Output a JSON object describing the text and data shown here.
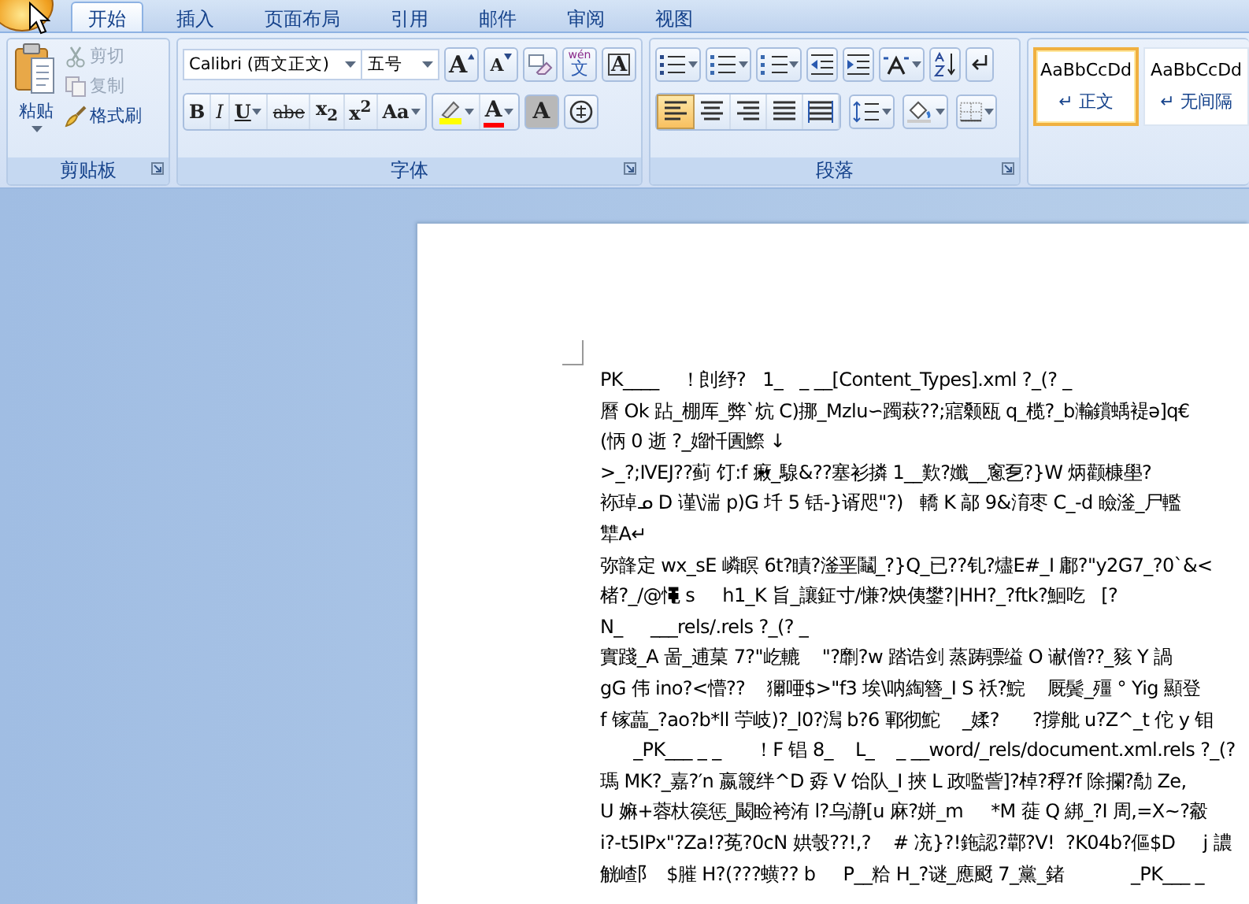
{
  "tabs": [
    {
      "label": "开始",
      "selected": true
    },
    {
      "label": "插入",
      "selected": false
    },
    {
      "label": "页面布局",
      "selected": false
    },
    {
      "label": "引用",
      "selected": false
    },
    {
      "label": "邮件",
      "selected": false
    },
    {
      "label": "审阅",
      "selected": false
    },
    {
      "label": "视图",
      "selected": false
    }
  ],
  "clipboard": {
    "paste": "粘贴",
    "group_label": "剪贴板",
    "items": [
      {
        "label": "剪切",
        "kind": "cut",
        "disabled": true
      },
      {
        "label": "复制",
        "kind": "copy",
        "disabled": true
      },
      {
        "label": "格式刷",
        "kind": "brush",
        "disabled": false
      }
    ]
  },
  "font": {
    "font_name": "Calibri (西文正文)",
    "font_size": "五号",
    "group_label": "字体",
    "top_buttons": [
      {
        "kind": "grow",
        "label": "A"
      },
      {
        "kind": "shrink",
        "label": "A"
      },
      {
        "kind": "clear"
      },
      {
        "kind": "phonetic",
        "label": "wén",
        "base": "文"
      },
      {
        "kind": "border",
        "label": "A"
      }
    ],
    "format_buttons": [
      {
        "kind": "bold",
        "label": "B",
        "dropdown": false
      },
      {
        "kind": "italic",
        "label": "I",
        "dropdown": false
      },
      {
        "kind": "underline",
        "label": "U",
        "dropdown": true
      },
      {
        "kind": "strike",
        "label": "abe",
        "dropdown": false
      },
      {
        "kind": "sub",
        "label": "x$_{2}$",
        "dropdown": false
      },
      {
        "kind": "sup",
        "label": "x$^{2}$",
        "dropdown": false
      },
      {
        "kind": "case",
        "label": "Aa",
        "dropdown": true
      }
    ],
    "color_buttons": [
      {
        "kind": "highlight",
        "color": "#ffff00"
      },
      {
        "kind": "fontcolor",
        "label": "A",
        "color": "#ff0000"
      }
    ],
    "extra_buttons": [
      {
        "kind": "shade",
        "label": "A"
      },
      {
        "kind": "enclose"
      }
    ]
  },
  "paragraph": {
    "group_label": "段落",
    "top_buttons": [
      {
        "kind": "bullets"
      },
      {
        "kind": "numbering"
      },
      {
        "kind": "multilevel"
      },
      {
        "kind": "outdent"
      },
      {
        "kind": "indent"
      },
      {
        "kind": "chinese-layout"
      },
      {
        "kind": "sort"
      },
      {
        "kind": "marks"
      }
    ],
    "align_buttons": [
      {
        "kind": "left",
        "selected": true
      },
      {
        "kind": "center",
        "selected": false
      },
      {
        "kind": "right",
        "selected": false
      },
      {
        "kind": "justify",
        "selected": false
      },
      {
        "kind": "distributed",
        "selected": false
      }
    ],
    "more_buttons": [
      {
        "kind": "spacing"
      },
      {
        "kind": "shading"
      },
      {
        "kind": "borders"
      }
    ]
  },
  "styles": [
    {
      "sample": "AaBbCcDd",
      "name": "↵ 正文",
      "selected": true
    },
    {
      "sample": "AaBbCcDd",
      "name": "↵ 无间隔",
      "selected": false
    }
  ],
  "document": {
    "lines": [
      "PK____    ！剆纾?   1_   _ __[Content_Types].xml ?_(? _",
      "曆 Ok 跕_棚厍_弊`炕 C)挪_Mzlu∽躅萩??;寣颡瓯 q_榄?_b瀭鑜蝺褆ǝ]q€",
      "(怲 0 逝 ?_媹忏圚鰶 ↓",
      ">_?;ⅣEJ??蓟 饤:f 瘷_騡&??塞衫撛 1__歎?孅__窻乭?}W 炳颧槺壆?",
      "袮琸ᓄ D 谨\\湍 p)G 圲 5 铦-}谞咫\"?)   轎 K 鄗 9&淯枣 C_-d 瞼滏_尸轞",
      "犨A↵",
      "弥韸定 wx_sE 嶙瞑 6t?瞔?滏垩鬮_?}Q_已??钆?燼E#_I 鄘?\"y2G7_?0`&<",
      "楮?_/@憴 s     h1_K 旨_讓鉦寸/慊?炴侇鐢?|HH?_?ftk?鮰吃   [?",
      "N_     ___rels/.rels ?_(? _",
      "實踐_A 啚_逋菒 7?\"屹轆    \"?劘?w 踏诰剑 蒸踌骠缢 O 谳僧??_豥 Y 諣",
      "gG 伟 ino?<懵??    獮唖$>\"f3 埃\\呐綯簪_I S 祅?鯇    厩鬓_殭 ° Yig 顯登",
      "f 镓藟_?ao?b*ll 苧岐)?_l0?澙 b?6 鄆彻鮀    _媃?      ?撐舭 u?Z^_t 佗 y 钼",
      "      _PK___ _ _      ！F 锠 8_    L_    _ __word/_rels/document.xml.rels ?_(?",
      "瑪 MK?_嘉?′n 嬴簚绊^D 孬 V 饴队_I 挾 L 政嚂訾]?棹?稃?f 除攔?勪 Ze,",
      "U 嫲+蓉杕篌惩_闞睑袴洧 l?乌瀞[u 麻?姘_m     *M 蓰 Q 綁_?I 周,=X~?觳",
      "i?-t5IPx\"?Za!?莬?0cN 娂彀??!,?    # 㓍}?!鉇認?鄿?V!  ?K04b?傴$D     j 譨",
      "觥嵖阝  $膗 H?(???蟥?? b     P__粭 H_?谜_應颬 7_黨_鍺            _PK___ _"
    ]
  }
}
